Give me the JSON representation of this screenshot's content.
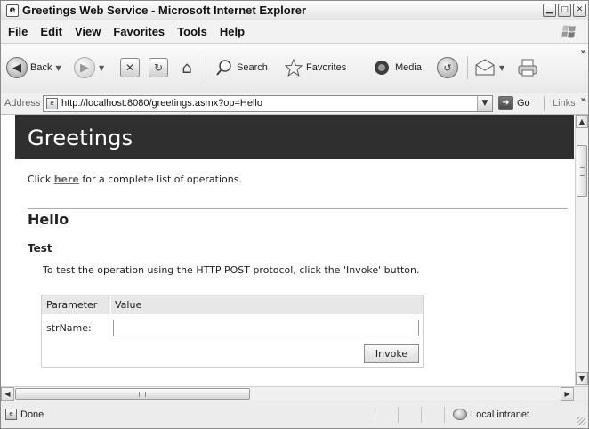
{
  "window": {
    "title": "Greetings Web Service - Microsoft Internet Explorer",
    "controls": [
      "minimize",
      "maximize",
      "close"
    ]
  },
  "menubar": {
    "items": [
      "File",
      "Edit",
      "View",
      "Favorites",
      "Tools",
      "Help"
    ]
  },
  "toolbar": {
    "back_label": "Back",
    "search_label": "Search",
    "favorites_label": "Favorites",
    "media_label": "Media"
  },
  "addressbar": {
    "label": "Address",
    "url": "http://localhost:8080/greetings.asmx?op=Hello",
    "go_label": "Go",
    "links_label": "Links"
  },
  "page": {
    "header_title": "Greetings",
    "intro_prefix": "Click ",
    "intro_link": "here",
    "intro_suffix": " for a complete list of operations.",
    "operation_title": "Hello",
    "test_title": "Test",
    "test_description": "To test the operation using the HTTP POST protocol, click the 'Invoke' button.",
    "param_table": {
      "col_parameter": "Parameter",
      "col_value": "Value",
      "param_name": "strName:",
      "param_value": ""
    },
    "invoke_label": "Invoke"
  },
  "statusbar": {
    "status_text": "Done",
    "zone_text": "Local intranet"
  },
  "colors": {
    "header_bg": "#2f2f2f",
    "link": "#6b6b6b"
  }
}
